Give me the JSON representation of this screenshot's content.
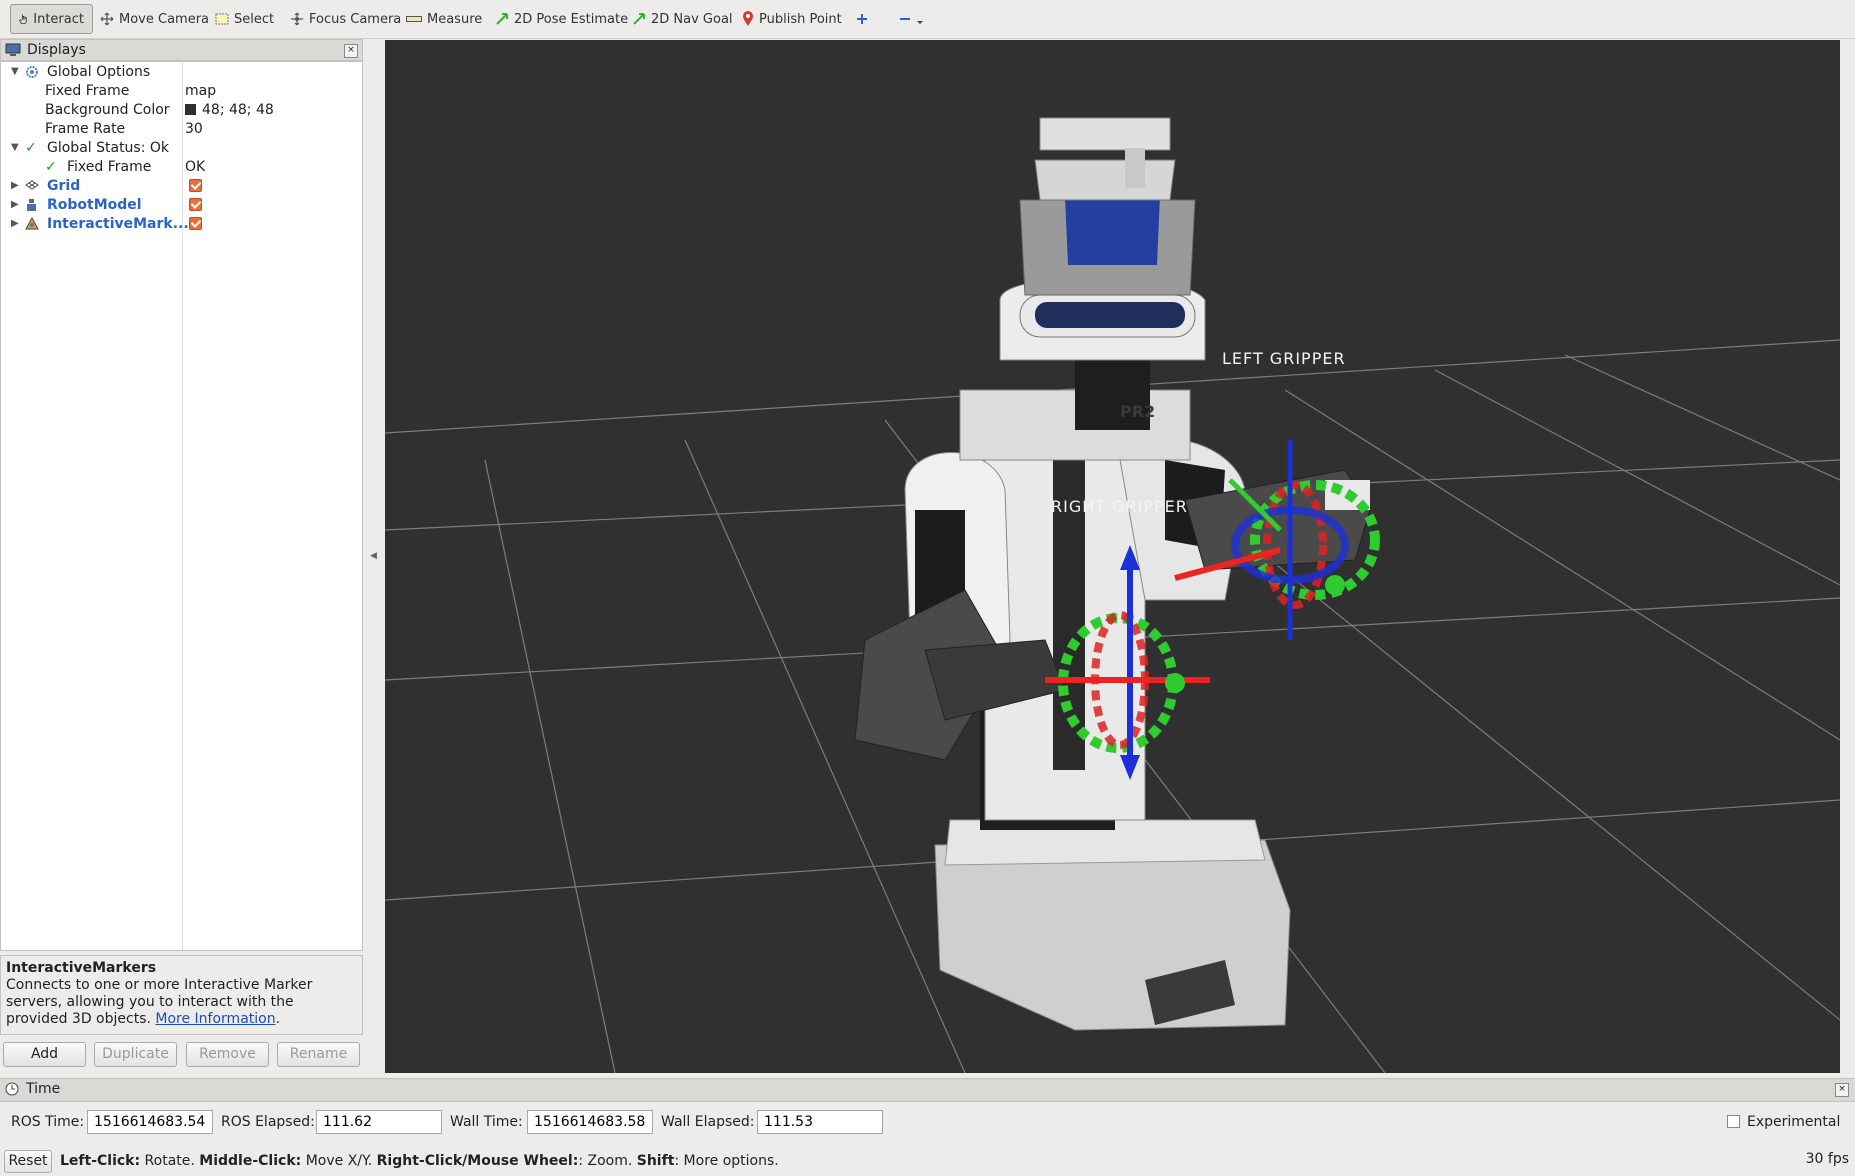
{
  "toolbar": {
    "interact": "Interact",
    "move_camera": "Move Camera",
    "select": "Select",
    "focus_camera": "Focus Camera",
    "measure": "Measure",
    "pose_estimate": "2D Pose Estimate",
    "nav_goal": "2D Nav Goal",
    "publish_point": "Publish Point"
  },
  "displays": {
    "title": "Displays",
    "global_options": "Global Options",
    "fixed_frame_label": "Fixed Frame",
    "fixed_frame_value": "map",
    "bg_color_label": "Background Color",
    "bg_color_value": "48; 48; 48",
    "frame_rate_label": "Frame Rate",
    "frame_rate_value": "30",
    "global_status": "Global Status: Ok",
    "status_fixed_frame": "Fixed Frame",
    "status_fixed_frame_value": "OK",
    "items": [
      "Grid",
      "RobotModel",
      "InteractiveMark..."
    ]
  },
  "description": {
    "title": "InteractiveMarkers",
    "text": "Connects to one or more Interactive Marker servers, allowing you to interact with the provided 3D objects.",
    "link": "More Information",
    "link_suffix": "."
  },
  "buttons": {
    "add": "Add",
    "duplicate": "Duplicate",
    "remove": "Remove",
    "rename": "Rename"
  },
  "viewport": {
    "left_gripper_label": "LEFT  GRIPPER",
    "right_gripper_label": "RIGHT  GRIPPER",
    "robot_badge": "PR2",
    "background_color": "#303030"
  },
  "time": {
    "title": "Time",
    "ros_time_label": "ROS Time:",
    "ros_time_value": "1516614683.54",
    "ros_elapsed_label": "ROS Elapsed:",
    "ros_elapsed_value": "111.62",
    "wall_time_label": "Wall Time:",
    "wall_time_value": "1516614683.58",
    "wall_elapsed_label": "Wall Elapsed:",
    "wall_elapsed_value": "111.53",
    "experimental": "Experimental"
  },
  "status": {
    "reset": "Reset",
    "b1": "Left-Click:",
    "t1": " Rotate. ",
    "b2": "Middle-Click:",
    "t2": " Move X/Y. ",
    "b3": "Right-Click/Mouse Wheel:",
    "t3": ": Zoom. ",
    "b4": "Shift",
    "t4": ": More options.",
    "fps": "30 fps"
  }
}
